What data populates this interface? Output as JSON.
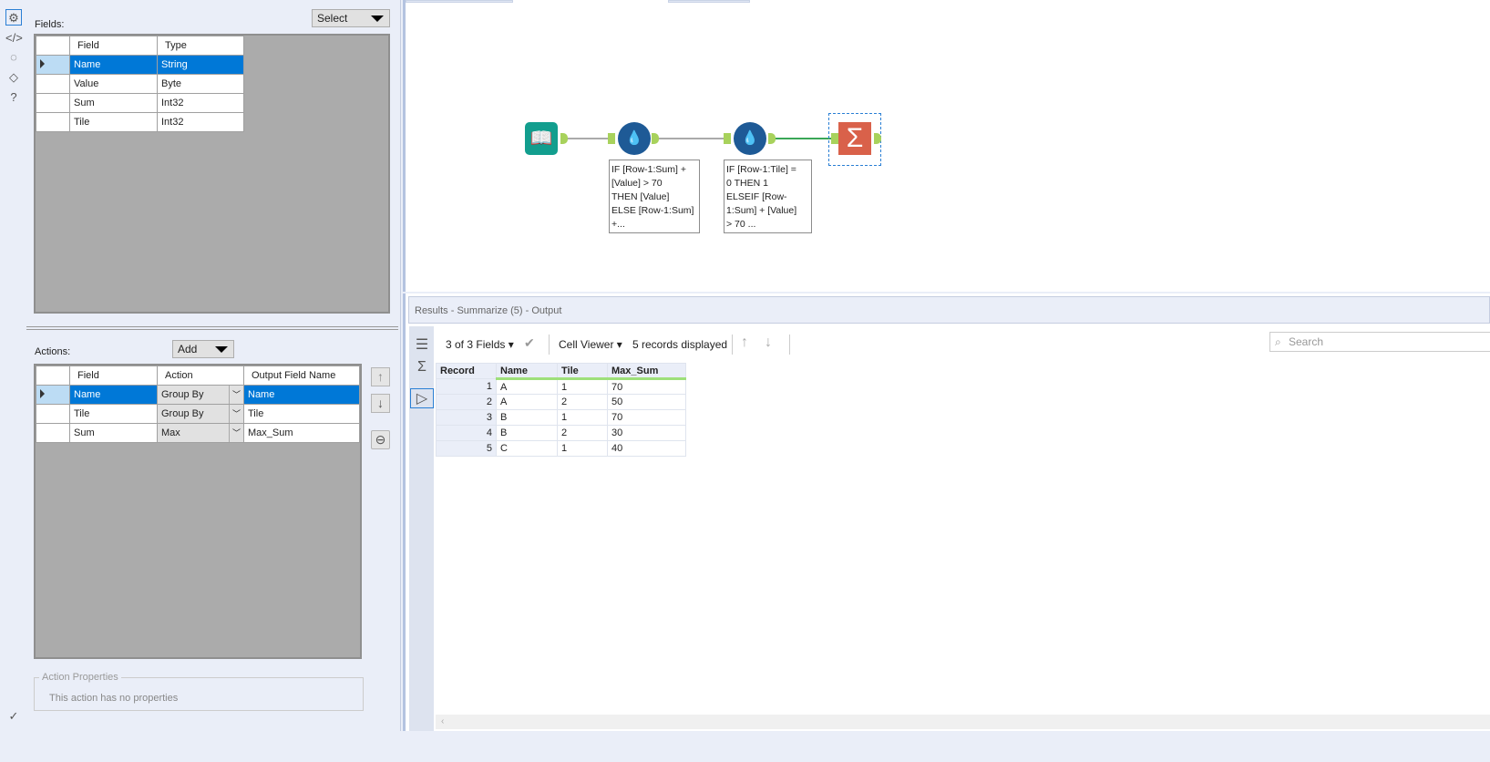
{
  "left_toolbar": {
    "icons": [
      "gear-icon",
      "code-icon",
      "annotation-icon",
      "tag-icon",
      "help-icon"
    ]
  },
  "fields": {
    "label": "Fields:",
    "select_label": "Select",
    "headers": [
      "Field",
      "Type"
    ],
    "rows": [
      {
        "field": "Name",
        "type": "String"
      },
      {
        "field": "Value",
        "type": "Byte"
      },
      {
        "field": "Sum",
        "type": "Int32"
      },
      {
        "field": "Tile",
        "type": "Int32"
      }
    ]
  },
  "actions": {
    "label": "Actions:",
    "add_label": "Add",
    "headers": [
      "Field",
      "Action",
      "Output Field Name"
    ],
    "rows": [
      {
        "field": "Name",
        "action": "Group By",
        "output": "Name"
      },
      {
        "field": "Tile",
        "action": "Group By",
        "output": "Tile"
      },
      {
        "field": "Sum",
        "action": "Max",
        "output": "Max_Sum"
      }
    ]
  },
  "action_properties": {
    "title": "Action Properties",
    "text": "This action has no properties"
  },
  "workflow": {
    "annotations": [
      "IF [Row-1:Sum] +\n[Value] > 70\nTHEN [Value]\nELSE [Row-1:Sum]\n+...",
      "IF [Row-1:Tile] =\n0 THEN 1\nELSEIF [Row-\n1:Sum] + [Value]\n> 70 ..."
    ]
  },
  "results": {
    "title": "Results - Summarize (5) - Output",
    "fields_label": "3 of 3 Fields",
    "cell_viewer": "Cell Viewer",
    "records_displayed": "5 records displayed",
    "search_placeholder": "Search",
    "headers": [
      "Record",
      "Name",
      "Tile",
      "Max_Sum"
    ],
    "rows": [
      {
        "record": "1",
        "name": "A",
        "tile": "1",
        "max_sum": "70"
      },
      {
        "record": "2",
        "name": "A",
        "tile": "2",
        "max_sum": "50"
      },
      {
        "record": "3",
        "name": "B",
        "tile": "1",
        "max_sum": "70"
      },
      {
        "record": "4",
        "name": "B",
        "tile": "2",
        "max_sum": "30"
      },
      {
        "record": "5",
        "name": "C",
        "tile": "1",
        "max_sum": "40"
      }
    ]
  }
}
